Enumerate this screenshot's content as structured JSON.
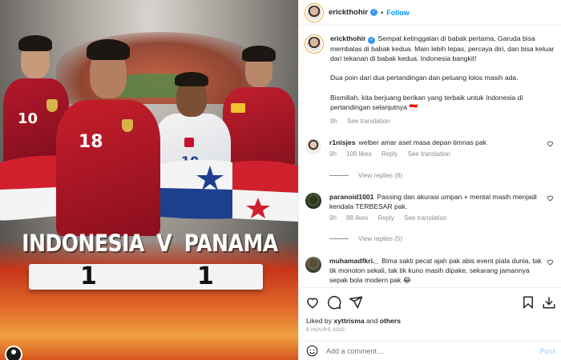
{
  "poster": {
    "team_home": "INDONESIA",
    "versus": "V",
    "team_away": "PANAMA",
    "score_home": "1",
    "score_away": "1",
    "jersey_left": "10",
    "jersey_center": "18",
    "jersey_panama": "10"
  },
  "header": {
    "username": "erickthohir",
    "verified_glyph": "✓",
    "separator": "•",
    "follow_label": "Follow"
  },
  "caption": {
    "username": "erickthohir",
    "paragraph_1": "Sempat ketinggalan di babak pertama, Garuda bisa membalas di babak kedua. Main lebih lepas, percaya diri, dan bisa keluar dari tekanan di babak kedua. Indonesia bangkit!",
    "paragraph_2": "Dua poin dari dua pertandingan dan peluang lolos masih ada.",
    "paragraph_3": "Bismillah, kita berjuang berikan yang terbaik untuk Indonesia di pertandingan selanjutnya",
    "flag_emoji": "🇮🇩",
    "time": "9h",
    "see_translation": "See translation"
  },
  "comments": [
    {
      "username": "r1nisjes",
      "text": "welber amar aset masa depan timnas pak",
      "time": "9h",
      "likes": "109 likes",
      "reply": "Reply",
      "see_translation": "See translation",
      "view_replies": "View replies (8)"
    },
    {
      "username": "paranoid1001",
      "text": "Passing dan akurasi umpan + mental masih menjadi kendala TERBESAR pak.",
      "time": "9h",
      "likes": "88 likes",
      "reply": "Reply",
      "see_translation": "See translation",
      "view_replies": "View replies (5)"
    },
    {
      "username": "muhamadfkri._",
      "text": "Bima sakti pecat ajah pak abis event piala dunia, tak tik monoton sekali, tak tik kuno masih dipake, sekarang jamannya sepak bola modern pak",
      "emoji": "😂"
    }
  ],
  "actions": {
    "like_icon": "heart-icon",
    "comment_icon": "comment-icon",
    "share_icon": "share-icon",
    "save_icon": "bookmark-icon",
    "download_icon": "download-icon"
  },
  "likes": {
    "prefix": "Liked by",
    "user": "xyttrisma",
    "and": "and",
    "others": "others"
  },
  "timestamp": "9 HOURS AGO",
  "add_comment": {
    "placeholder": "Add a comment…",
    "post_label": "Post"
  }
}
